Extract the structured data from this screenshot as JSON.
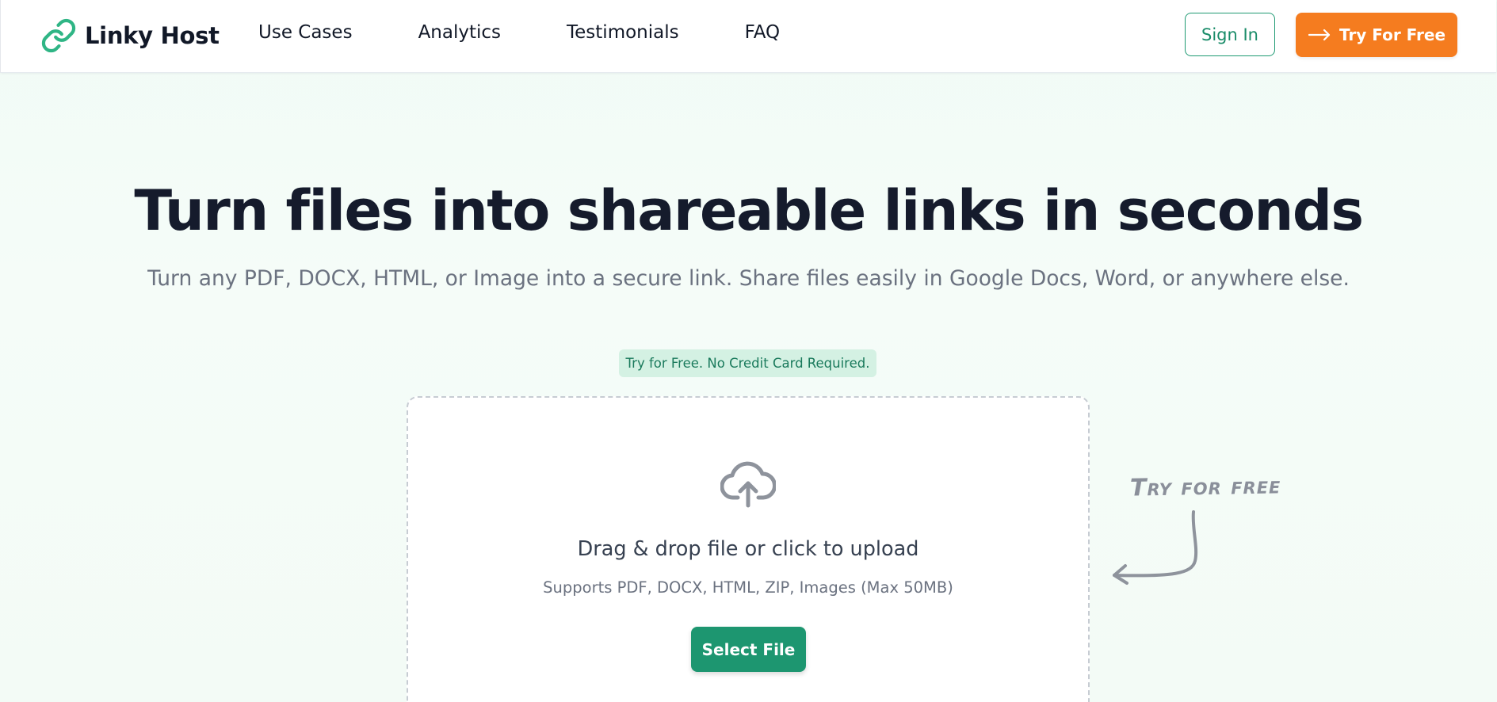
{
  "header": {
    "brand": "Linky Host",
    "nav": [
      {
        "label": "Use Cases"
      },
      {
        "label": "Analytics"
      },
      {
        "label": "Testimonials"
      },
      {
        "label": "FAQ"
      }
    ],
    "sign_in_label": "Sign In",
    "try_free_label": "Try For Free"
  },
  "hero": {
    "title": "Turn files into shareable links in seconds",
    "subtitle": "Turn any PDF, DOCX, HTML, or Image into a secure link. Share files easily in Google Docs, Word, or anywhere else.",
    "badge": "Try for Free. No Credit Card Required."
  },
  "upload": {
    "title": "Drag & drop file or click to upload",
    "hint": "Supports PDF, DOCX, HTML, ZIP, Images (Max 50MB)",
    "button_label": "Select File"
  },
  "annotation": {
    "text": "Try for free"
  },
  "icons": {
    "brand": "chain-link-icon",
    "try_free": "arrow-right-icon",
    "upload": "cloud-upload-icon",
    "annotation_arrow": "curved-arrow-icon"
  },
  "colors": {
    "brand_green": "#1d9670",
    "accent_orange": "#f57c1f",
    "badge_bg": "#d4f1e3",
    "heading": "#151b2c",
    "muted_text": "#6b7280"
  }
}
